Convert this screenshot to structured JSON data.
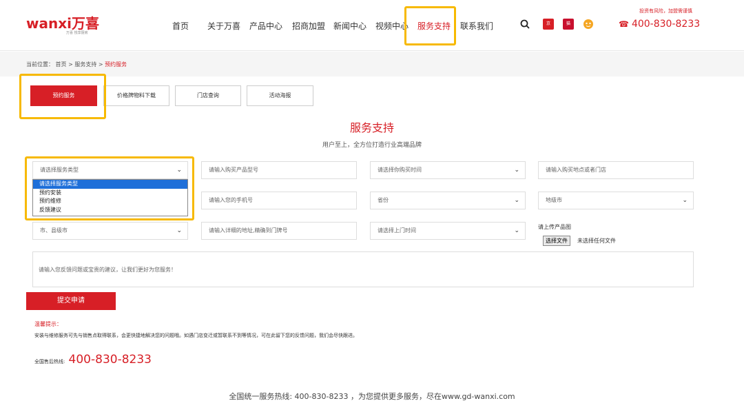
{
  "header": {
    "logo_text": "wanxi万喜",
    "logo_tagline": "万喜 悦享厨房",
    "nav": [
      {
        "label": "首页"
      },
      {
        "label": "关于万喜"
      },
      {
        "label": "产品中心"
      },
      {
        "label": "招商加盟"
      },
      {
        "label": "新闻中心"
      },
      {
        "label": "视频中心"
      },
      {
        "label": "服务支持",
        "active": true
      },
      {
        "label": "联系我们"
      }
    ],
    "risk_notice": "投资有风险，加盟需谨慎",
    "hotline": "400-830-8233",
    "icons": [
      "search-icon",
      "jd-icon",
      "tmall-icon",
      "mascot-icon",
      "phone-icon"
    ]
  },
  "breadcrumb": {
    "prefix": "当前位置：",
    "path": "首页 > 服务支持 > ",
    "current": "预约服务"
  },
  "tabs": [
    {
      "label": "预约服务",
      "active": true
    },
    {
      "label": "价格牌物料下载"
    },
    {
      "label": "门店查询"
    },
    {
      "label": "活动海报"
    }
  ],
  "section": {
    "title": "服务支持",
    "subtitle": "用户至上，全方位打造行业高端品牌"
  },
  "form": {
    "service_type": {
      "placeholder": "请选择服务类型",
      "options": [
        "请选择服务类型",
        "预约安装",
        "预约维修",
        "反馈建议"
      ],
      "selected_index": 0
    },
    "product_model": "请输入购买产品型号",
    "purchase_time": "请选择你购买时间",
    "purchase_place": "请输入购买地点或者门店",
    "phone": "请输入您的手机号",
    "province": "省份",
    "city": "地级市",
    "county": "市、县级市",
    "address": "请输入详细的地址,精确到门牌号",
    "visit_time": "请选择上门时间",
    "upload_label": "请上传产品图",
    "upload_button": "选择文件",
    "upload_status": "未选择任何文件",
    "feedback": "请输入您反馈问题或宝贵的建议，让我们更好为您服务！",
    "submit": "提交申请"
  },
  "tips": {
    "title": "温馨提示：",
    "body": "安装与维修服务可先与销售点取得联系，会更快捷地解决您的问题哦。如遇门店变迁或暂联系不到等情况，可在此留下您的反馈问题，我们会尽快跟进。",
    "aftersale_label": "全国售后热线:",
    "aftersale_number": "400-830-8233"
  },
  "footer": {
    "text": "全国统一服务热线: 400-830-8233 ，为您提供更多服务，尽在www.gd-wanxi.com"
  },
  "colors": {
    "brand_red": "#d71f26",
    "highlight": "#f7b900",
    "select_blue": "#1e6fd9"
  }
}
